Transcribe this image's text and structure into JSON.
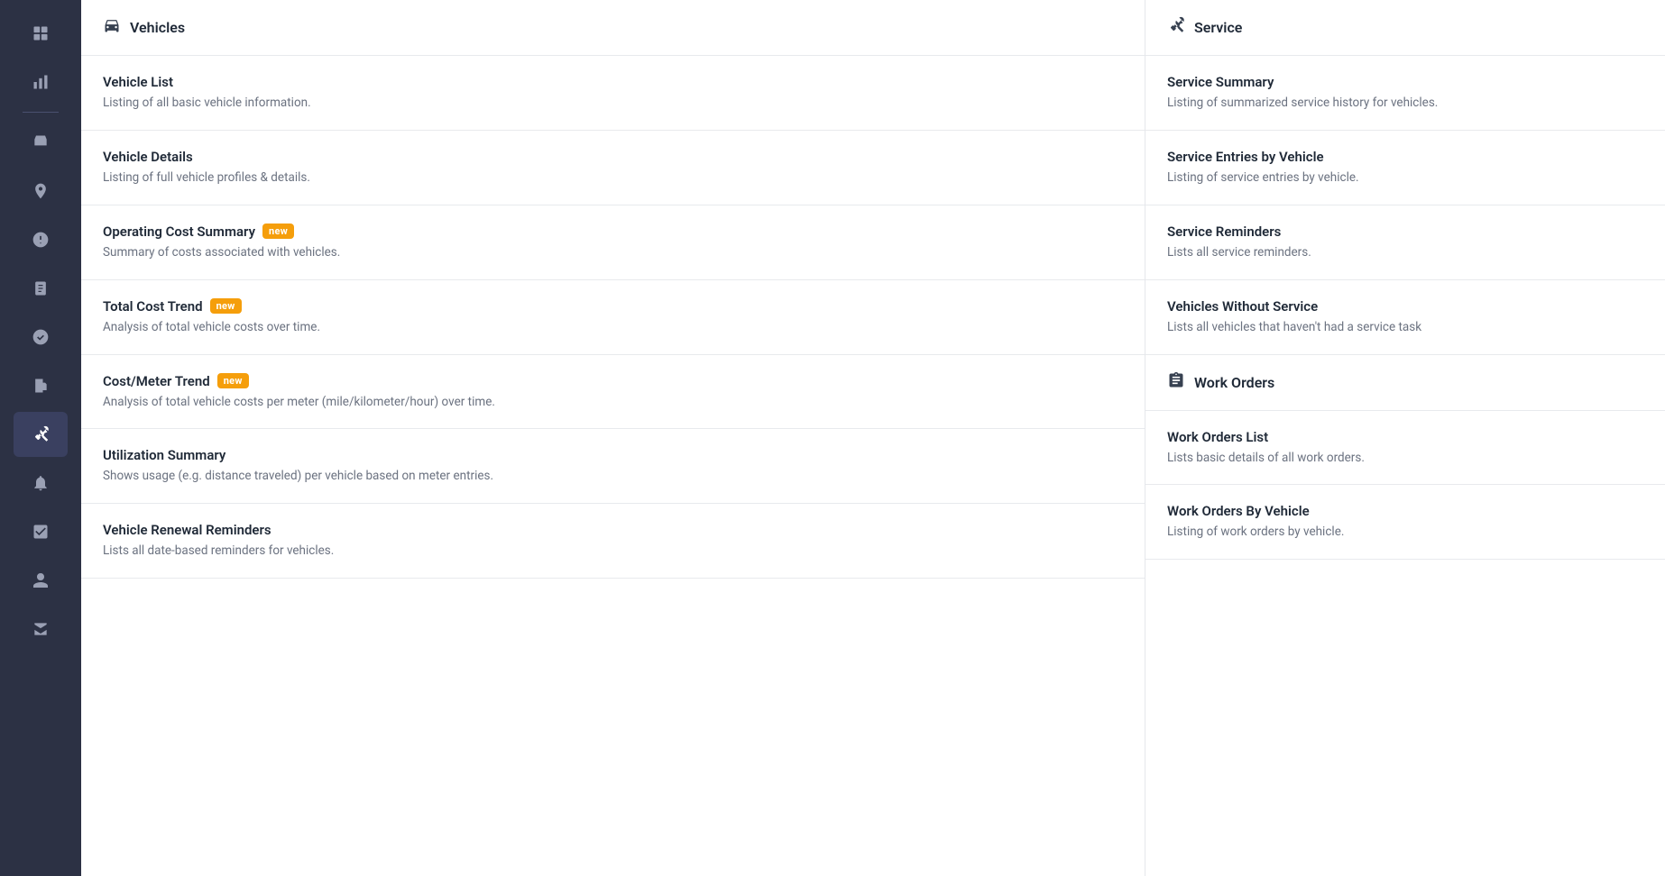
{
  "sidebar": {
    "items": [
      {
        "name": "dashboard",
        "icon": "⊞",
        "active": false
      },
      {
        "name": "analytics",
        "icon": "📊",
        "active": false
      },
      {
        "name": "vehicles",
        "icon": "🚗",
        "active": false
      },
      {
        "name": "map",
        "icon": "◆",
        "active": false
      },
      {
        "name": "alerts",
        "icon": "⚠",
        "active": false
      },
      {
        "name": "tasks",
        "icon": "📋",
        "active": false
      },
      {
        "name": "check",
        "icon": "✔",
        "active": false
      },
      {
        "name": "fuel",
        "icon": "⛽",
        "active": false
      },
      {
        "name": "service",
        "icon": "🔧",
        "active": true
      },
      {
        "name": "bell",
        "icon": "🔔",
        "active": false
      },
      {
        "name": "checklist",
        "icon": "☑",
        "active": false
      },
      {
        "name": "user",
        "icon": "👤",
        "active": false
      },
      {
        "name": "store",
        "icon": "🏪",
        "active": false
      }
    ]
  },
  "left_panel": {
    "section": {
      "icon": "car",
      "title": "Vehicles"
    },
    "reports": [
      {
        "title": "Vehicle List",
        "desc": "Listing of all basic vehicle information.",
        "badge": null
      },
      {
        "title": "Vehicle Details",
        "desc": "Listing of full vehicle profiles & details.",
        "badge": null
      },
      {
        "title": "Operating Cost Summary",
        "desc": "Summary of costs associated with vehicles.",
        "badge": "new"
      },
      {
        "title": "Total Cost Trend",
        "desc": "Analysis of total vehicle costs over time.",
        "badge": "new"
      },
      {
        "title": "Cost/Meter Trend",
        "desc": "Analysis of total vehicle costs per meter (mile/kilometer/hour) over time.",
        "badge": "new"
      },
      {
        "title": "Utilization Summary",
        "desc": "Shows usage (e.g. distance traveled) per vehicle based on meter entries.",
        "badge": null
      },
      {
        "title": "Vehicle Renewal Reminders",
        "desc": "Lists all date-based reminders for vehicles.",
        "badge": null
      }
    ]
  },
  "right_panel": {
    "section": {
      "icon": "wrench",
      "title": "Service"
    },
    "reports": [
      {
        "title": "Service Summary",
        "desc": "Listing of summarized service history for vehicles.",
        "badge": null
      },
      {
        "title": "Service Entries by Vehicle",
        "desc": "Listing of service entries by vehicle.",
        "badge": null
      },
      {
        "title": "Service Reminders",
        "desc": "Lists all service reminders.",
        "badge": null
      },
      {
        "title": "Vehicles Without Service",
        "desc": "Lists all vehicles that haven't had a service task",
        "badge": null
      }
    ],
    "section2": {
      "icon": "clipboard",
      "title": "Work Orders"
    },
    "reports2": [
      {
        "title": "Work Orders List",
        "desc": "Lists basic details of all work orders.",
        "badge": null
      },
      {
        "title": "Work Orders By Vehicle",
        "desc": "Listing of work orders by vehicle.",
        "badge": null
      }
    ]
  }
}
